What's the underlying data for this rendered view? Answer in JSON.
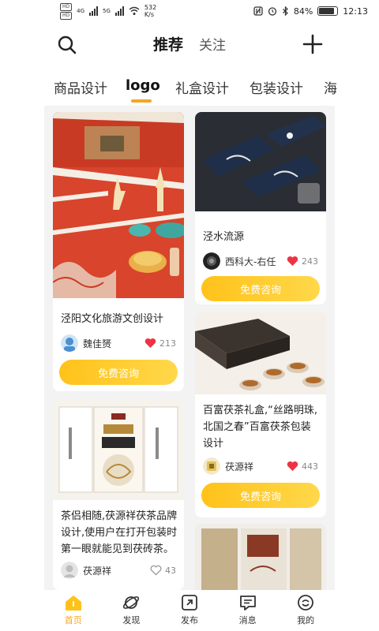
{
  "status_bar": {
    "hd1": "HD",
    "hd2": "HD",
    "net1": "4G",
    "net2": "5G",
    "speed_value": "532",
    "speed_unit": "K/s",
    "battery_text": "84%",
    "battery_level": 0.84,
    "time": "12:13"
  },
  "header": {
    "tab_recommend": "推荐",
    "tab_follow": "关注"
  },
  "categories": [
    "商品设计",
    "logo",
    "礼盒设计",
    "包装设计",
    "海"
  ],
  "active_category": "logo",
  "cards": [
    {
      "title": "泾阳文化旅游文创设计",
      "author": "魏佳赟",
      "likes": "213",
      "liked": true,
      "button": "免费咨询"
    },
    {
      "title": "泾水流源",
      "author": "西科大-右任",
      "likes": "243",
      "liked": true,
      "button": "免费咨询"
    },
    {
      "title": "百富茯茶礼盒,“丝路明珠,北国之春”百富茯茶包装设计",
      "author": "茯源祥",
      "likes": "443",
      "liked": true,
      "button": "免费咨询"
    },
    {
      "title": "茶侣相随,茯源祥茯茶品牌设计,使用户在打开包装时第一眼就能见到茯砖茶。",
      "author": "茯源祥",
      "likes": "43",
      "liked": false
    }
  ],
  "nav": [
    {
      "label": "首页",
      "icon": "home-icon"
    },
    {
      "label": "发现",
      "icon": "planet-icon"
    },
    {
      "label": "发布",
      "icon": "publish-icon"
    },
    {
      "label": "消息",
      "icon": "message-icon"
    },
    {
      "label": "我的",
      "icon": "profile-icon"
    }
  ],
  "colors": {
    "accent": "#f5a623",
    "button_gradient_start": "#ffc21a",
    "button_gradient_end": "#ffd84a",
    "like_red": "#ee3344",
    "feed_bg": "#f3f3f3"
  }
}
